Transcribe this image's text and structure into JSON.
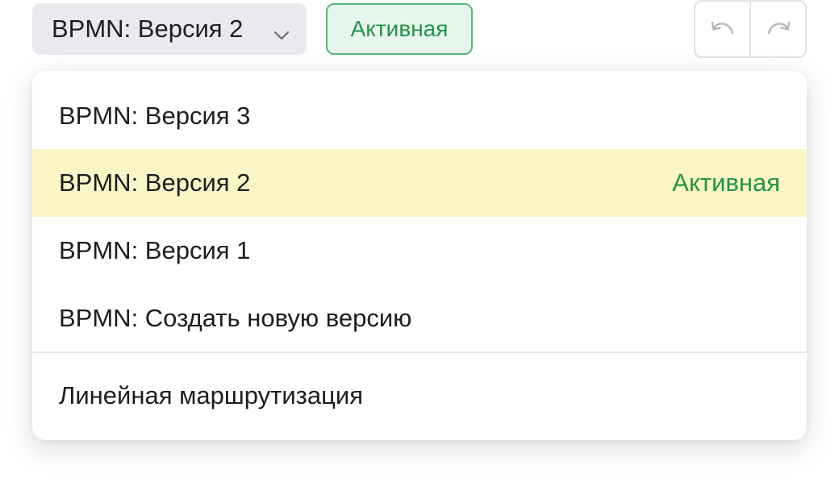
{
  "toolbar": {
    "version_select": {
      "value": "BPMN: Версия 2",
      "icon": "chevron-down-icon"
    },
    "status_chip": "Активная",
    "history": {
      "undo_icon": "undo-icon",
      "redo_icon": "redo-icon"
    }
  },
  "dropdown": {
    "items": [
      {
        "label": "BPMN: Версия 3",
        "badge": ""
      },
      {
        "label": "BPMN: Версия 2",
        "badge": "Активная",
        "selected": true
      },
      {
        "label": "BPMN: Версия 1",
        "badge": ""
      },
      {
        "label": "BPMN: Создать новую версию",
        "badge": ""
      }
    ],
    "extra_items": [
      {
        "label": "Линейная маршрутизация"
      }
    ]
  },
  "colors": {
    "select_bg": "#e9eaed",
    "chip_border": "#57b97a",
    "chip_bg": "#e7f6ec",
    "active_text": "#23934a",
    "selected_row_bg": "#fcf5c6",
    "icon_gray": "#b8b8bc"
  }
}
